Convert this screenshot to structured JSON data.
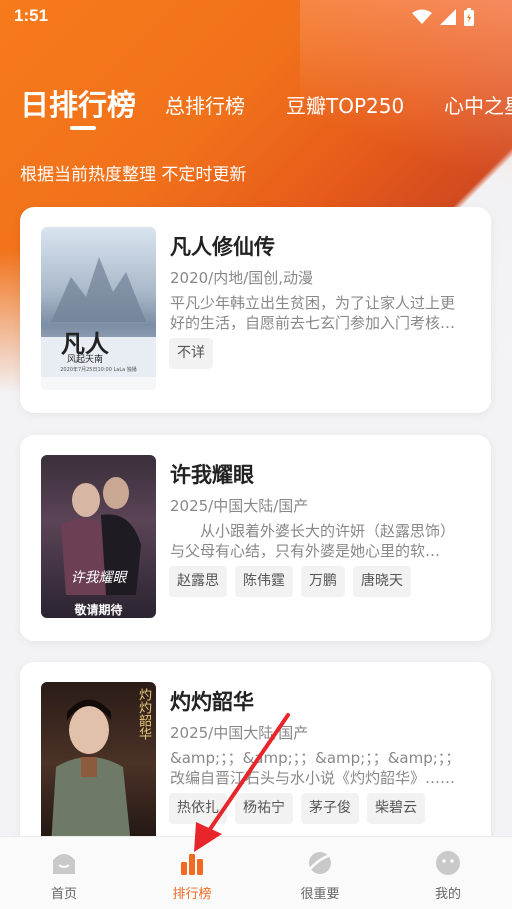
{
  "status_bar": {
    "time": "1:51"
  },
  "tabs": [
    {
      "label": "日排行榜",
      "active": true
    },
    {
      "label": "总排行榜",
      "active": false
    },
    {
      "label": "豆瓣TOP250",
      "active": false
    },
    {
      "label": "心中之星",
      "active": false
    }
  ],
  "subtitle": "根据当前热度整理 不定时更新",
  "cards": [
    {
      "title": "凡人修仙传",
      "meta": "2020/内地/国创,动漫",
      "desc": "平凡少年韩立出生贫困，为了让家人过上更好的生活，自愿前去七玄门参加入门考核，最终被传授炼丹药的墨大夫收入门下……",
      "chips": [
        "不详"
      ],
      "poster": {
        "title": "凡人",
        "subtitle": "风起天南",
        "caption": "2020年7月25日10:00 LaLa 独播"
      }
    },
    {
      "title": "许我耀眼",
      "meta": "2025/中国大陆/国产",
      "desc": "　　从小跟着外婆长大的许妍（赵露思饰）与父母有心结，只有外婆是她心里的软肋……",
      "chips": [
        "赵露思",
        "陈伟霆",
        "万鹏",
        "唐晓天"
      ],
      "poster": {
        "title": "许我耀眼",
        "caption": "敬请期待"
      }
    },
    {
      "title": "灼灼韶华",
      "meta": "2025/中国大陆/国产",
      "desc": "&amp;；；&amp;；；&amp;；；&amp;；；改编自晋江石头与水小说《灼灼韶华》……",
      "chips": [
        "热依扎",
        "杨祐宁",
        "茅子俊",
        "柴碧云"
      ],
      "poster": {
        "title": "灼灼韶华"
      }
    }
  ],
  "bottom_nav": [
    {
      "label": "首页",
      "icon": "home-icon",
      "active": false
    },
    {
      "label": "排行榜",
      "icon": "bar-chart-icon",
      "active": true
    },
    {
      "label": "很重要",
      "icon": "planet-icon",
      "active": false
    },
    {
      "label": "我的",
      "icon": "smile-face-icon",
      "active": false
    }
  ],
  "colors": {
    "accent": "#f06a22",
    "hero": "#f0711b"
  }
}
